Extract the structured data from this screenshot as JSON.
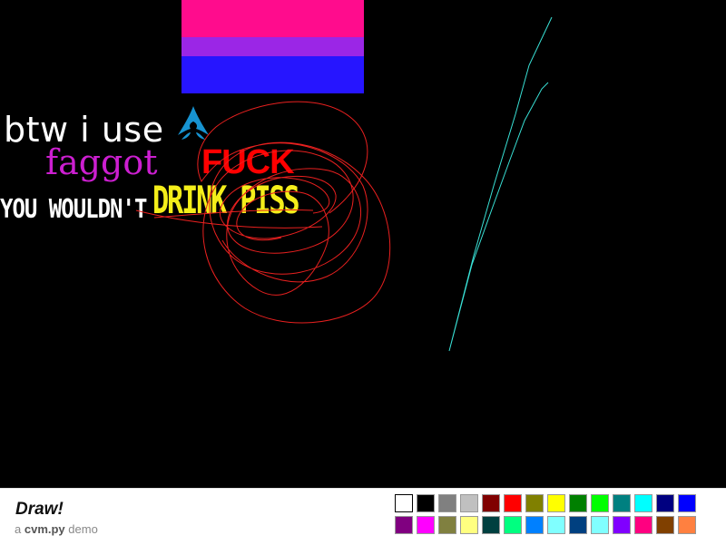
{
  "canvas": {
    "background": "#000000",
    "flag_colors": [
      "#ff0c8d",
      "#9b26e6",
      "#2615ff"
    ],
    "texts": {
      "btw": "btw i use",
      "slur": "faggot",
      "fuck": "FUCK",
      "you": "YOU WOULDN'T",
      "drink": "DRINK PISS"
    },
    "arch_icon": "arch-linux-logo",
    "stroke_colors": {
      "red": "#e8201f",
      "cyan": "#39e1d6"
    }
  },
  "toolbar": {
    "title": "Draw!",
    "subtitle_prefix": "a",
    "subtitle_brand": "cvm.py",
    "subtitle_suffix": "demo"
  },
  "palette": {
    "row1": [
      "#ffffff",
      "#000000",
      "#808080",
      "#c0c0c0",
      "#800000",
      "#ff0000",
      "#808000",
      "#ffff00",
      "#008000",
      "#00ff00",
      "#008080",
      "#00ffff",
      "#000080",
      "#0000ff"
    ],
    "row2": [
      "#800080",
      "#ff00ff",
      "#808040",
      "#ffff80",
      "#004040",
      "#00ff80",
      "#0080ff",
      "#80ffff",
      "#004080",
      "#80ffff",
      "#8000ff",
      "#ff0080",
      "#804000",
      "#ff8040"
    ]
  }
}
